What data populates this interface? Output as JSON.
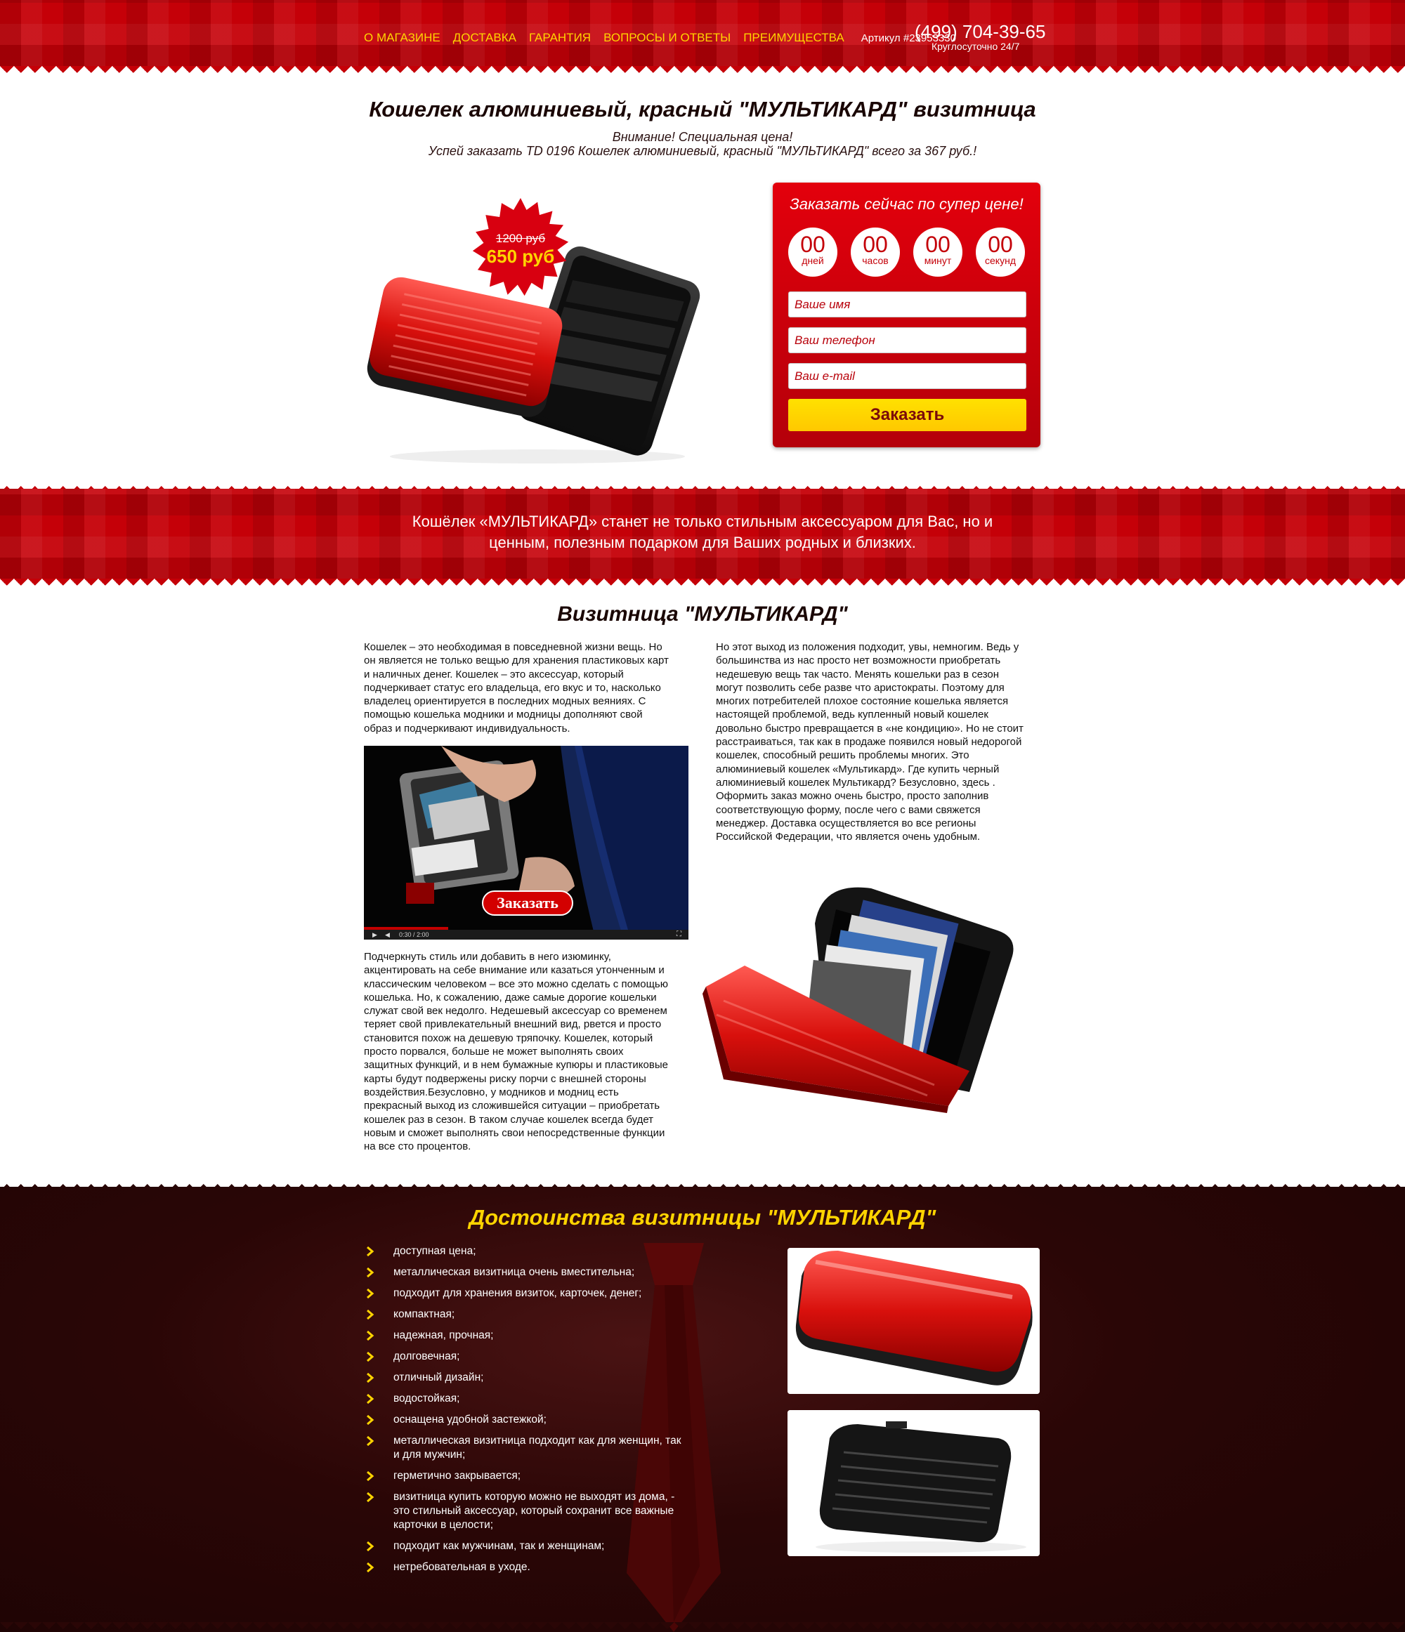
{
  "header": {
    "nav": [
      "О МАГАЗИНЕ",
      "ДОСТАВКА",
      "ГАРАНТИЯ",
      "ВОПРОСЫ И ОТВЕТЫ",
      "ПРЕИМУЩЕСТВА"
    ],
    "sku": "Артикул #23953330",
    "phone": "(499) 704-39-65",
    "phone_note": "Круглосуточно 24/7"
  },
  "hero": {
    "title": "Кошелек алюминиевый, красный \"МУЛЬТИКАРД\" визитница",
    "notice_1": "Внимание! Специальная цена!",
    "notice_2": "Успей заказать TD 0196 Кошелек алюминиевый, красный \"МУЛЬТИКАРД\" всего за 367 руб.!",
    "old_price": "1200 руб",
    "new_price": "650 руб"
  },
  "order_form": {
    "title": "Заказать сейчас по супер цене!",
    "timer": [
      {
        "value": "00",
        "label": "дней"
      },
      {
        "value": "00",
        "label": "часов"
      },
      {
        "value": "00",
        "label": "минут"
      },
      {
        "value": "00",
        "label": "секунд"
      }
    ],
    "name_placeholder": "Ваше имя",
    "phone_placeholder": "Ваш телефон",
    "email_placeholder": "Ваш e-mail",
    "submit_label": "Заказать"
  },
  "banner": {
    "line_1": "Кошёлек «МУЛЬТИКАРД» станет не только стильным аксессуаром для Вас, но и",
    "line_2": "ценным, полезным подарком для Ваших родных и близких."
  },
  "article": {
    "title": "Визитница \"МУЛЬТИКАРД\"",
    "left_top": [
      "Кошелек – это необходимая в повседневной жизни вещь. Но",
      "он является не только вещью для хранения пластиковых карт",
      "и наличных денег. Кошелек – это аксессуар, который",
      "подчеркивает статус его владельца, его вкус и то, насколько",
      "владелец ориентируется в последних модных веяниях. С",
      "помощью кошелька модники и модницы дополняют свой",
      "образ и подчеркивают индивидуальность."
    ],
    "left_bottom": [
      "Подчеркнуть стиль или добавить в него изюминку,",
      "акцентировать на себе внимание или казаться утонченным и",
      "классическим человеком – все это можно сделать с помощью",
      "кошелька. Но, к сожалению, даже самые дорогие кошельки",
      "служат свой век недолго. Недешевый аксессуар со временем",
      "теряет свой привлекательный внешний вид, рвется и просто",
      "становится похож на дешевую тряпочку. Кошелек, который",
      "просто порвался, больше не может выполнять своих",
      "защитных функций, и в нем бумажные купюры и пластиковые",
      "карты будут подвержены риску порчи с внешней стороны",
      "воздействия.Безусловно, у модников и модниц есть",
      "прекрасный выход из сложившейся ситуации – приобретать",
      "кошелек раз в сезон. В таком случае кошелек всегда будет",
      "новым и сможет выполнять свои непосредственные функции",
      "на все сто процентов."
    ],
    "right": [
      "Но этот выход из положения подходит, увы, немногим. Ведь у",
      "большинства из нас просто нет возможности приобретать",
      "недешевую вещь так часто. Менять кошельки раз в сезон",
      "могут позволить себе разве что аристократы. Поэтому для",
      "многих потребителей плохое состояние кошелька является",
      "настоящей проблемой, ведь купленный новый кошелек",
      "довольно быстро превращается в «не кондицию». Но не стоит",
      "расстраиваться, так как в продаже появился новый недорогой",
      "кошелек, способный решить проблемы многих. Это",
      "алюминиевый кошелек «Мультикард». Где купить черный",
      "алюминиевый кошелек Мультикард? Безусловно, здесь .",
      "Оформить заказ можно очень быстро, просто заполнив",
      "соответствующую форму, после чего с вами свяжется",
      "менеджер. Доставка осуществляется во все регионы",
      "Российской Федерации, что является очень удобным."
    ],
    "video_order_label": "Заказать",
    "video_time": "0:30 / 2:00",
    "video_progress": 0.26
  },
  "advantages": {
    "title": "Достоинства визитницы \"МУЛЬТИКАРД\"",
    "items": [
      "доступная цена;",
      "металлическая визитница очень вместительна;",
      "подходит для хранения визиток, карточек, денег;",
      "компактная;",
      "надежная, прочная;",
      "долговечная;",
      "отличный дизайн;",
      " водостойкая;",
      "оснащена удобной застежкой;",
      "металлическая визитница подходит как для женщин, так и для мужчин;",
      "герметично закрывается;",
      "визитница купить которую можно не выходят из дома, - это стильный аксессуар, который сохранит все важные карточки в целости;",
      "подходит как мужчинам, так и женщинам;",
      "нетребовательная в уходе."
    ]
  },
  "colors": {
    "brand_red": "#c50008",
    "accent_yellow": "#ffd400",
    "dark_bg": "#2a0606"
  }
}
